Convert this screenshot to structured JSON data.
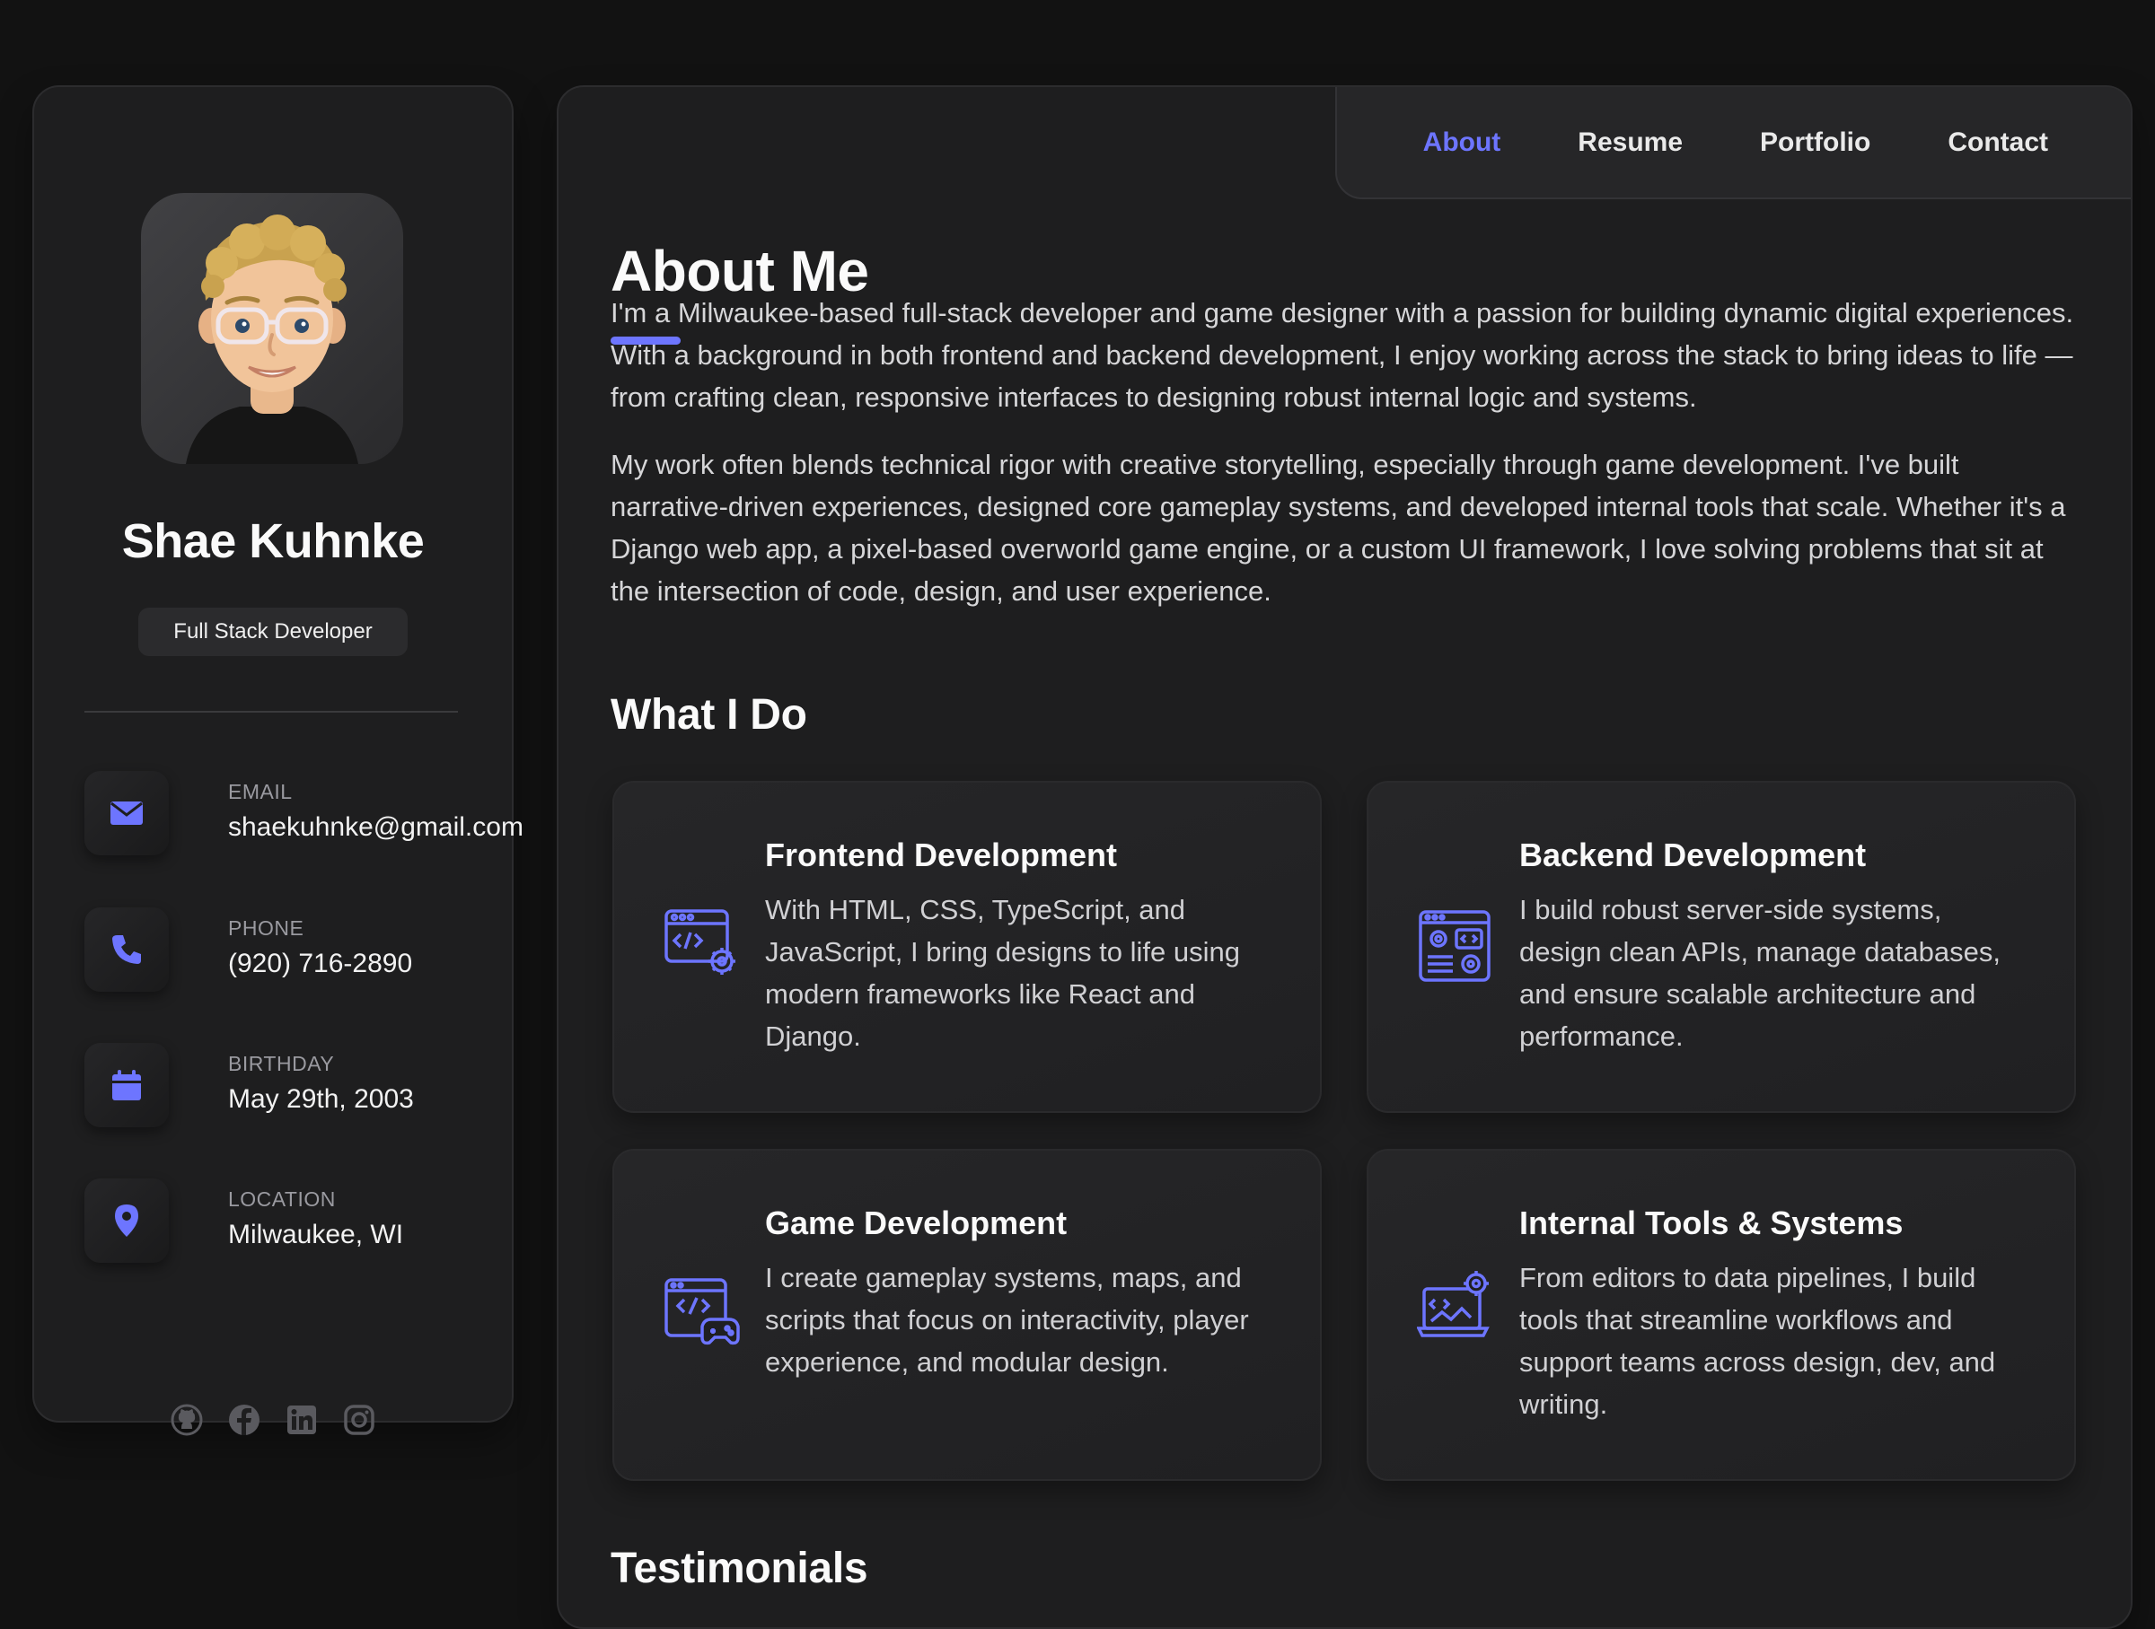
{
  "sidebar": {
    "name": "Shae Kuhnke",
    "role": "Full Stack Developer",
    "contacts": [
      {
        "label": "EMAIL",
        "value": "shaekuhnke@gmail.com",
        "icon": "envelope-icon"
      },
      {
        "label": "PHONE",
        "value": "(920) 716-2890",
        "icon": "phone-icon"
      },
      {
        "label": "BIRTHDAY",
        "value": "May 29th, 2003",
        "icon": "calendar-icon"
      },
      {
        "label": "LOCATION",
        "value": "Milwaukee, WI",
        "icon": "map-pin-icon"
      }
    ],
    "socials": [
      "github-icon",
      "facebook-icon",
      "linkedin-icon",
      "instagram-icon"
    ]
  },
  "nav": {
    "items": [
      "About",
      "Resume",
      "Portfolio",
      "Contact"
    ],
    "active": "About"
  },
  "about": {
    "title": "About Me",
    "paragraphs": [
      "I'm a Milwaukee-based full-stack developer and game designer with a passion for building dynamic digital experiences. With a background in both frontend and backend development, I enjoy working across the stack to bring ideas to life — from crafting clean, responsive interfaces to designing robust internal logic and systems.",
      "My work often blends technical rigor with creative storytelling, especially through game development. I've built narrative-driven experiences, designed core gameplay systems, and developed internal tools that scale. Whether it's a Django web app, a pixel-based overworld game engine, or a custom UI framework, I love solving problems that sit at the intersection of code, design, and user experience."
    ]
  },
  "services": {
    "title": "What I Do",
    "items": [
      {
        "title": "Frontend Development",
        "text": "With HTML, CSS, TypeScript, and JavaScript, I bring designs to life using modern frameworks like React and Django.",
        "icon": "web-code-gear-icon"
      },
      {
        "title": "Backend Development",
        "text": "I build robust server-side systems, design clean APIs, manage databases, and ensure scalable architecture and performance.",
        "icon": "server-dashboard-icon"
      },
      {
        "title": "Game Development",
        "text": "I create gameplay systems, maps, and scripts that focus on interactivity, player experience, and modular design.",
        "icon": "code-gamepad-icon"
      },
      {
        "title": "Internal Tools & Systems",
        "text": "From editors to data pipelines, I build tools that streamline workflows and support teams across design, dev, and writing.",
        "icon": "laptop-gear-icon"
      }
    ]
  },
  "testimonials": {
    "title": "Testimonials"
  },
  "colors": {
    "accent": "#6d75ff",
    "background": "#121212",
    "panel": "#1e1e1f"
  }
}
